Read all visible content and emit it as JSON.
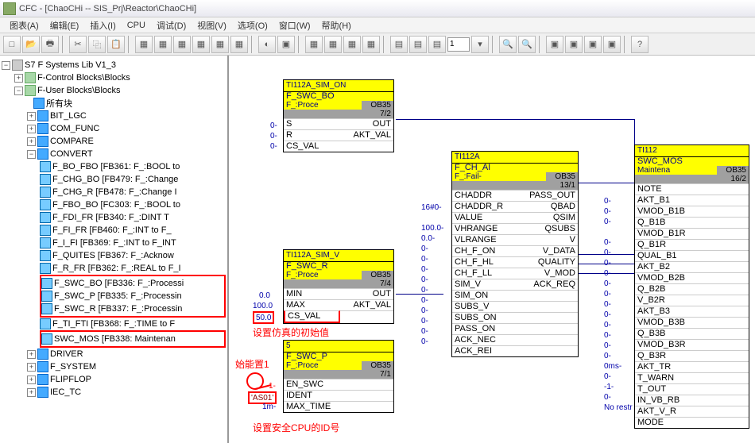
{
  "title": "CFC - [ChaoCHi -- SIS_Prj\\Reactor\\ChaoCHi]",
  "menu": [
    "图表(A)",
    "编辑(E)",
    "插入(I)",
    "CPU",
    "调试(D)",
    "视图(V)",
    "选项(O)",
    "窗口(W)",
    "帮助(H)"
  ],
  "toolbar_field": "1",
  "tree": {
    "root": "S7 F Systems Lib V1_3",
    "n1": "F-Control Blocks\\Blocks",
    "n2": "F-User Blocks\\Blocks",
    "items": [
      "所有块",
      "BIT_LGC",
      "COM_FUNC",
      "COMPARE",
      "CONVERT"
    ],
    "convert": [
      "F_BO_FBO  [FB361: F_:BOOL to",
      "F_CHG_BO  [FB479: F_:Change",
      "F_CHG_R  [FB478: F_:Change I",
      "F_FBO_BO  [FC303: F_:BOOL to",
      "F_FDI_FR  [FB340: F_:DINT T",
      "F_FI_FR  [FB460: F_:INT to F_",
      "F_I_FI  [FB369: F_:INT to F_INT",
      "F_QUITES  [FB367: F_:Acknow",
      "F_R_FR  [FB362: F_:REAL to F_I"
    ],
    "convert_hl": [
      "F_SWC_BO  [FB336: F_:Processi",
      "F_SWC_P  [FB335: F_:Processin",
      "F_SWC_R  [FB337: F_:Processin"
    ],
    "convert2": "F_TI_FTI  [FB368: F_:TIME to F",
    "convert_hl2": "SWC_MOS  [FB338: Maintenan",
    "tail": [
      "DRIVER",
      "F_SYSTEM",
      "FLIPFLOP",
      "IEC_TC"
    ]
  },
  "blocks": {
    "b1": {
      "t": "TI112A_SIM_ON",
      "s1": "F_SWC_BO",
      "s2": "F_:Proce",
      "ob": "OB35",
      "n": "7/2",
      "rows": [
        [
          "S",
          "OUT"
        ],
        [
          "R",
          "AKT_VAL"
        ],
        [
          "CS_VAL",
          ""
        ]
      ]
    },
    "b2": {
      "t": "TI112A_SIM_V",
      "s1": "F_SWC_R",
      "s2": "F_:Proce",
      "ob": "OB35",
      "n": "7/4",
      "rows": [
        [
          "MIN",
          "OUT"
        ],
        [
          "MAX",
          "AKT_VAL"
        ],
        [
          "CS_VAL",
          ""
        ]
      ]
    },
    "b3": {
      "t": "5",
      "s1": "F_SWC_P",
      "s2": "F_:Proce",
      "ob": "OB35",
      "n": "7/1",
      "rows": [
        [
          "EN_SWC",
          ""
        ],
        [
          "IDENT",
          ""
        ],
        [
          "MAX_TIME",
          ""
        ]
      ]
    },
    "b4": {
      "t": "TI112A",
      "s1": "F_CH_AI",
      "s2": "F_:Fail-",
      "ob": "OB35",
      "n": "13/1",
      "l": [
        "CHADDR",
        "CHADDR_R",
        "VALUE",
        "VHRANGE",
        "VLRANGE",
        "CH_F_ON",
        "CH_F_HL",
        "CH_F_LL",
        "SIM_V",
        "SIM_ON",
        "SUBS_V",
        "SUBS_ON",
        "PASS_ON",
        "ACK_NEC",
        "ACK_REI"
      ],
      "r": [
        "PASS_OUT",
        "QBAD",
        "QSIM",
        "QSUBS",
        "V",
        "V_DATA",
        "QUALITY",
        "V_MOD",
        "ACK_REQ",
        "",
        "",
        "",
        "",
        "",
        ""
      ]
    },
    "b5": {
      "t": "TI112",
      "s1": "SWC_MOS",
      "s2": "Maintena",
      "ob": "OB35",
      "n": "16/2",
      "l": [
        "NOTE",
        "AKT_B1",
        "VMOD_B1B",
        "Q_B1B",
        "VMOD_B1R",
        "Q_B1R",
        "QUAL_B1",
        "AKT_B2",
        "VMOD_B2B",
        "Q_B2B",
        "V_B2R",
        "AKT_B3",
        "VMOD_B3B",
        "Q_B3B",
        "VMOD_B3R",
        "Q_B3R",
        "AKT_TR",
        "T_WARN",
        "T_OUT",
        "IN_VB_RB",
        "AKT_V_R",
        "MODE"
      ]
    }
  },
  "pins": {
    "b1": [
      "0-",
      "0-",
      "0-"
    ],
    "b2": [
      "0.0",
      "100.0",
      "50.0"
    ],
    "b3": [
      "1-",
      "'AS01'",
      "1m-"
    ],
    "b4": [
      "",
      "16#0-",
      "",
      "100.0-",
      "0.0-",
      "0-",
      "0-",
      "0-",
      "0-",
      "0-",
      "0-",
      "0-",
      "0-",
      "0-",
      "0-"
    ],
    "b5": [
      "",
      "0-",
      "0-",
      "0-",
      "",
      "0-",
      "0-",
      "0-",
      "0-",
      "0-",
      "0-",
      "0-",
      "0-",
      "0-",
      "0-",
      "0-",
      "0-",
      "0ms-",
      "0-",
      "-1-",
      "0-",
      "No restr"
    ]
  },
  "annotations": {
    "a1": "设置仿真的初始值",
    "a2": "始能置1",
    "a3": "设置安全CPU的ID号"
  }
}
